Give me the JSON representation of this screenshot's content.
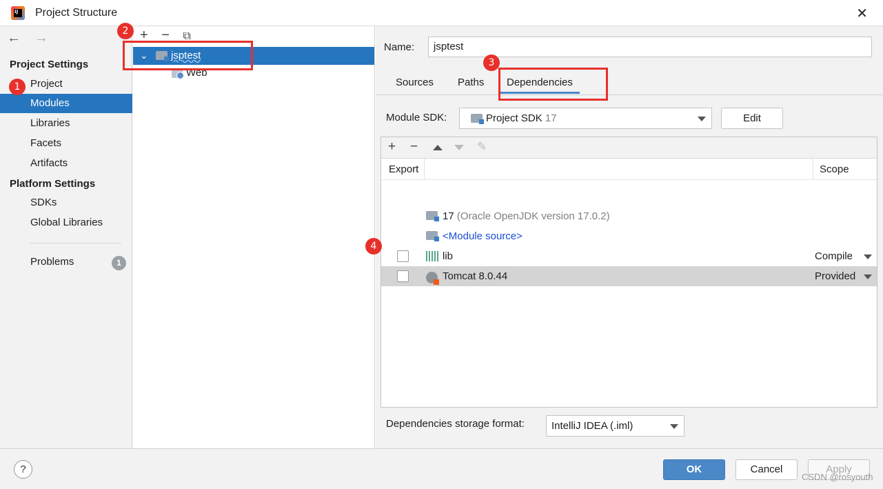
{
  "window": {
    "title": "Project Structure",
    "close_glyph": "✕",
    "icon_text": "IJ"
  },
  "nav": {
    "back_glyph": "←",
    "forward_glyph": "→",
    "project_settings_heading": "Project Settings",
    "project_settings_items": [
      "Project",
      "Modules",
      "Libraries",
      "Facets",
      "Artifacts"
    ],
    "selected_item": "Modules",
    "platform_settings_heading": "Platform Settings",
    "platform_settings_items": [
      "SDKs",
      "Global Libraries"
    ],
    "problems_label": "Problems",
    "problems_count": "1"
  },
  "tree": {
    "toolbar": {
      "add": "+",
      "remove": "−",
      "copy": "⧉"
    },
    "expander": "⌄",
    "module": "jsptest",
    "child": "Web"
  },
  "module": {
    "name_label": "Name:",
    "name_value": "jsptest",
    "tabs": [
      "Sources",
      "Paths",
      "Dependencies"
    ],
    "active_tab": "Dependencies",
    "sdk_label": "Module SDK:",
    "sdk_value": "Project SDK",
    "sdk_version": "17",
    "edit_button": "Edit"
  },
  "dependencies": {
    "toolbar": {
      "add": "+",
      "remove": "−",
      "edit": "✎"
    },
    "columns": {
      "export": "Export",
      "scope": "Scope"
    },
    "rows": [
      {
        "name": "17",
        "detail": "(Oracle OpenJDK version 17.0.2)",
        "scope": "",
        "checkbox": false,
        "icon": "jdk-folder-icon"
      },
      {
        "name": "<Module source>",
        "detail": "",
        "scope": "",
        "checkbox": false,
        "icon": "module-source-icon"
      },
      {
        "name": "lib",
        "detail": "",
        "scope": "Compile",
        "checkbox": true,
        "icon": "library-icon"
      },
      {
        "name": "Tomcat 8.0.44",
        "detail": "",
        "scope": "Provided",
        "checkbox": true,
        "icon": "tomcat-icon"
      }
    ],
    "storage_label": "Dependencies storage format:",
    "storage_value": "IntelliJ IDEA (.iml)"
  },
  "footer": {
    "help": "?",
    "ok": "OK",
    "cancel": "Cancel",
    "apply": "Apply"
  },
  "annotations": [
    "1",
    "2",
    "3",
    "4"
  ],
  "watermark": "CSDN @rosyouth",
  "colors": {
    "selection": "#2675bf",
    "annotation_red": "#e8302a",
    "ok_button": "#4a88c7"
  }
}
